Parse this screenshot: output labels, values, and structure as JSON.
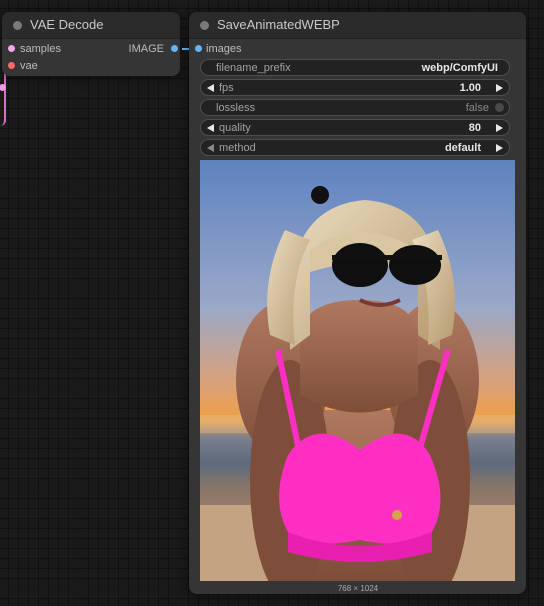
{
  "vae_decode_node": {
    "title": "VAE Decode",
    "inputs": [
      {
        "label": "samples",
        "color": "#f2a9e6"
      },
      {
        "label": "vae",
        "color": "#ff6b6b"
      }
    ],
    "outputs": [
      {
        "label": "IMAGE",
        "color": "#64b5f6"
      }
    ]
  },
  "save_node": {
    "title": "SaveAnimatedWEBP",
    "inputs": [
      {
        "label": "images",
        "color": "#64b5f6"
      }
    ],
    "widgets": {
      "filename_prefix": {
        "label": "filename_prefix",
        "value": "webp/ComfyUI"
      },
      "fps": {
        "label": "fps",
        "value": "1.00"
      },
      "lossless": {
        "label": "lossless",
        "value": "false"
      },
      "quality": {
        "label": "quality",
        "value": "80"
      },
      "method": {
        "label": "method",
        "value": "default"
      }
    },
    "preview": {
      "caption": "768 × 1024"
    }
  },
  "colors": {
    "canvas_bg": "#1a1a1a",
    "node_body": "#353535",
    "node_title": "#2b2b2b",
    "widget_bg": "#222222",
    "image_link": "#64b5f6",
    "latent_link": "#f2a9e6"
  },
  "icons": [
    "node-status-dot-icon",
    "arrow-left-icon",
    "arrow-right-icon",
    "toggle-icon"
  ]
}
